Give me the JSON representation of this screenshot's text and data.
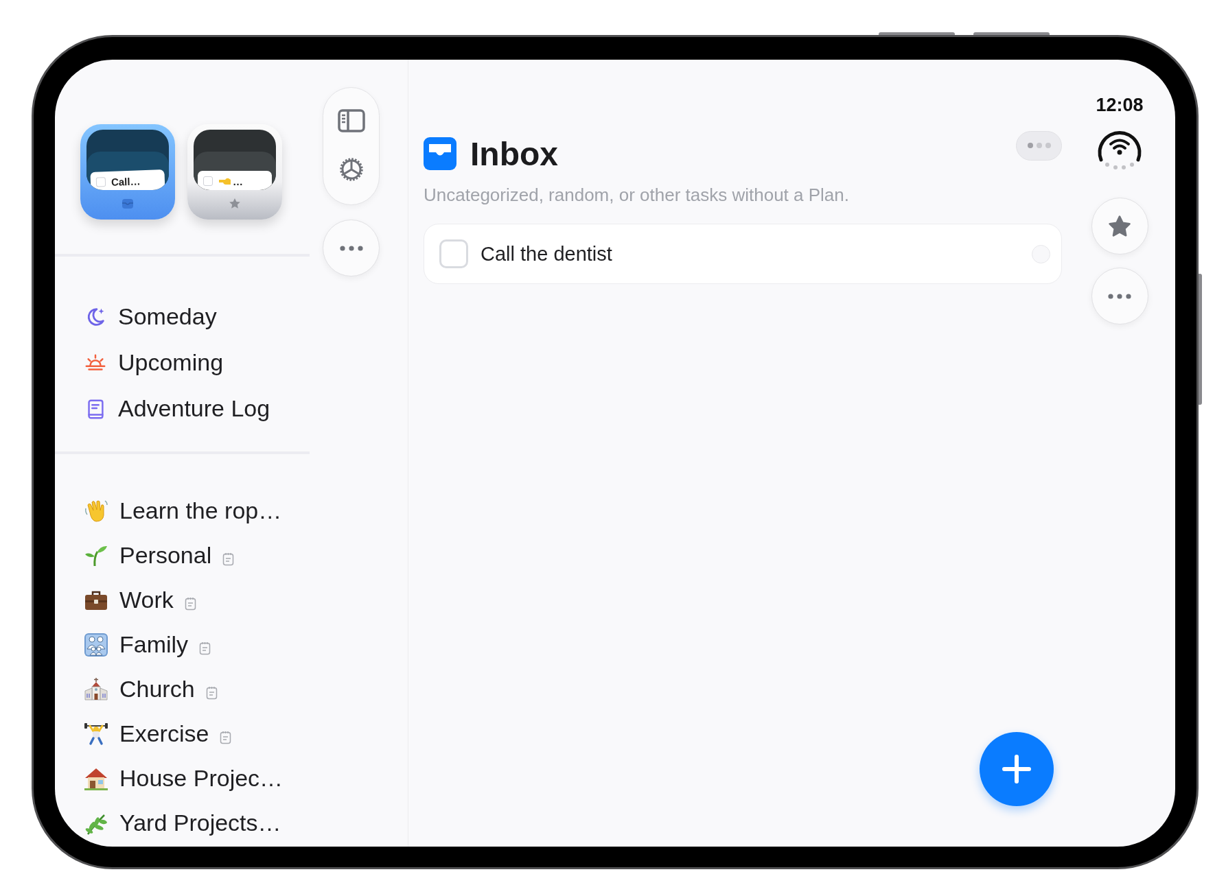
{
  "sidebar": {
    "cards": [
      {
        "kind": "inbox",
        "label": "Call…",
        "selected": true
      },
      {
        "kind": "starred",
        "label": "…",
        "selected": false
      }
    ],
    "nav": [
      {
        "label": "Someday"
      },
      {
        "label": "Upcoming"
      },
      {
        "label": "Adventure Log"
      }
    ],
    "projects": [
      {
        "label": "Learn the rop…",
        "has_notes": false
      },
      {
        "label": "Personal",
        "has_notes": true
      },
      {
        "label": "Work",
        "has_notes": true
      },
      {
        "label": "Family",
        "has_notes": true
      },
      {
        "label": "Church",
        "has_notes": true
      },
      {
        "label": "Exercise",
        "has_notes": true
      },
      {
        "label": "House Projec…",
        "has_notes": false
      },
      {
        "label": "Yard Projects…",
        "has_notes": false
      }
    ]
  },
  "main": {
    "title": "Inbox",
    "subtitle": "Uncategorized, random, or other tasks without a Plan.",
    "tasks": [
      {
        "title": "Call the dentist",
        "checked": false
      }
    ]
  },
  "status_bar": {
    "time": "12:08"
  }
}
